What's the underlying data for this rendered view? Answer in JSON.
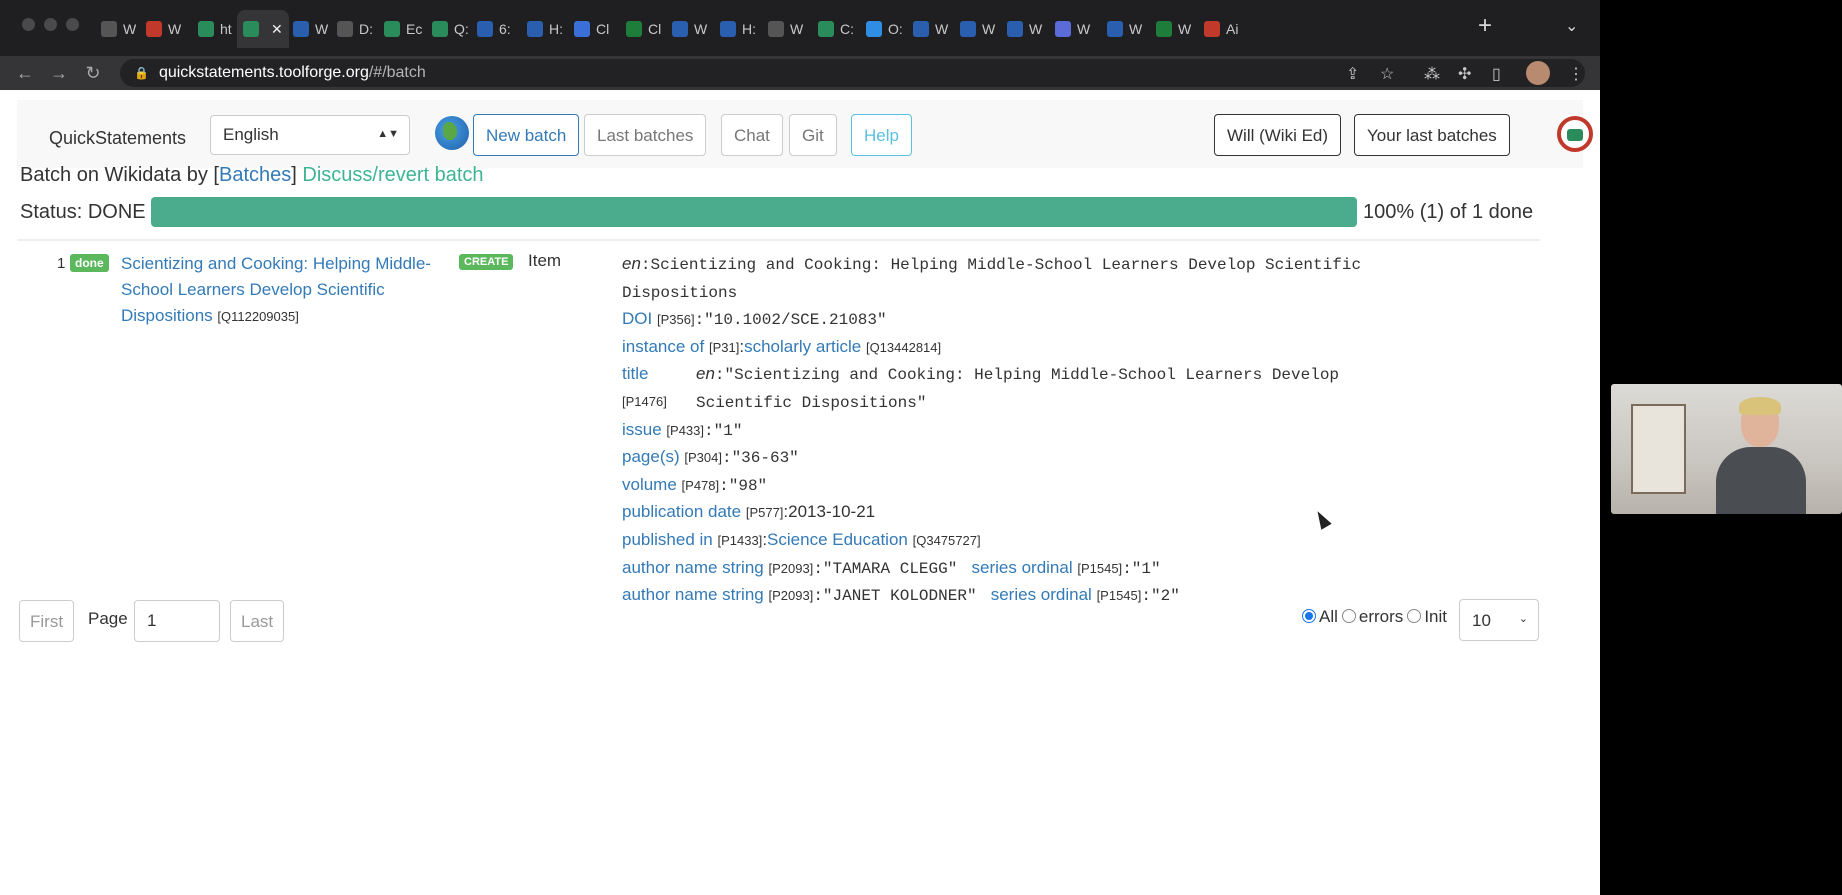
{
  "browser": {
    "tabs": [
      {
        "label": "W",
        "color": "#555"
      },
      {
        "label": "W",
        "color": "#c0392b"
      },
      {
        "label": "ht",
        "color": "#2a8c5a"
      },
      {
        "label": "",
        "color": "#2a8c5a",
        "active": true
      },
      {
        "label": "W",
        "color": "#2a5fb0"
      },
      {
        "label": "D:",
        "color": "#555"
      },
      {
        "label": "Ec",
        "color": "#2a8c5a"
      },
      {
        "label": "Q:",
        "color": "#2a8c5a"
      },
      {
        "label": "6:",
        "color": "#2a5fb0"
      },
      {
        "label": "H:",
        "color": "#2a5fb0"
      },
      {
        "label": "Cl",
        "color": "#3a6fd8"
      },
      {
        "label": "Cl",
        "color": "#1e7d3a"
      },
      {
        "label": "W",
        "color": "#2a5fb0"
      },
      {
        "label": "H:",
        "color": "#2a5fb0"
      },
      {
        "label": "W",
        "color": "#555"
      },
      {
        "label": "C:",
        "color": "#2a8c5a"
      },
      {
        "label": "O:",
        "color": "#2f8de4"
      },
      {
        "label": "W",
        "color": "#2a5fb0"
      },
      {
        "label": "W",
        "color": "#2a5fb0"
      },
      {
        "label": "W",
        "color": "#2a5fb0"
      },
      {
        "label": "W",
        "color": "#5b6bd8"
      },
      {
        "label": "W",
        "color": "#2a5fb0"
      },
      {
        "label": "W",
        "color": "#1e7d3a"
      },
      {
        "label": "Ai",
        "color": "#c0392b"
      }
    ],
    "url_domain": "quickstatements.toolforge.org",
    "url_path": "/#/batch"
  },
  "navbar": {
    "brand": "QuickStatements",
    "language": "English",
    "buttons": {
      "new_batch": "New batch",
      "last_batches": "Last batches",
      "chat": "Chat",
      "git": "Git",
      "help": "Help",
      "user": "Will (Wiki Ed)",
      "your_last_batches": "Your last batches"
    }
  },
  "batch": {
    "prefix": "Batch on Wikidata by [",
    "batches_link": "Batches",
    "bracket_close": "]",
    "discuss_link": "Discuss/revert batch",
    "status_label": "Status: DONE",
    "progress_fraction": 1.0,
    "progress_text": "100% (1) of 1 done",
    "progress_color": "#4aac8c"
  },
  "rows": [
    {
      "number": "1",
      "status": "done",
      "item_title": "Scientizing and Cooking: Helping Middle-School Learners Develop Scientific Dispositions",
      "qid": "[Q112209035]",
      "action": "CREATE",
      "type": "Item",
      "label_lang": "en",
      "label_value": ":Scientizing and Cooking: Helping Middle-School Learners Develop Scientific Dispositions",
      "statements": {
        "doi": {
          "prop": "DOI",
          "pid": "[P356]",
          "value": ":\"10.1002/SCE.21083\""
        },
        "instance": {
          "prop": "instance of",
          "pid": "[P31]",
          "sep": ":",
          "value": "scholarly article",
          "qid": "[Q13442814]"
        },
        "title": {
          "prop": "title",
          "pid": "[P1476]",
          "lang": "en",
          "value": ":\"Scientizing and Cooking: Helping Middle-School Learners Develop Scientific Dispositions\""
        },
        "issue": {
          "prop": "issue",
          "pid": "[P433]",
          "value": ":\"1\""
        },
        "pages": {
          "prop": "page(s)",
          "pid": "[P304]",
          "value": ":\"36-63\""
        },
        "volume": {
          "prop": "volume",
          "pid": "[P478]",
          "value": ":\"98\""
        },
        "pubdate": {
          "prop": "publication date",
          "pid": "[P577]",
          "value": ":2013-10-21"
        },
        "publishedin": {
          "prop": "published in",
          "pid": "[P1433]",
          "sep": ":",
          "value": "Science Education",
          "qid": "[Q3475727]"
        },
        "author1": {
          "prop": "author name string",
          "pid": "[P2093]",
          "value": ":\"TAMARA CLEGG\"",
          "qual": "series ordinal",
          "qpid": "[P1545]",
          "qvalue": ":\"1\""
        },
        "author2": {
          "prop": "author name string",
          "pid": "[P2093]",
          "value": ":\"JANET KOLODNER\"",
          "qual": "series ordinal",
          "qpid": "[P1545]",
          "qvalue": ":\"2\""
        }
      }
    }
  ],
  "pagination": {
    "first": "First",
    "page_label": "Page",
    "page_value": "1",
    "last": "Last",
    "filter_all": "All",
    "filter_errors": "errors",
    "filter_init": "Init",
    "per_page": "10"
  }
}
